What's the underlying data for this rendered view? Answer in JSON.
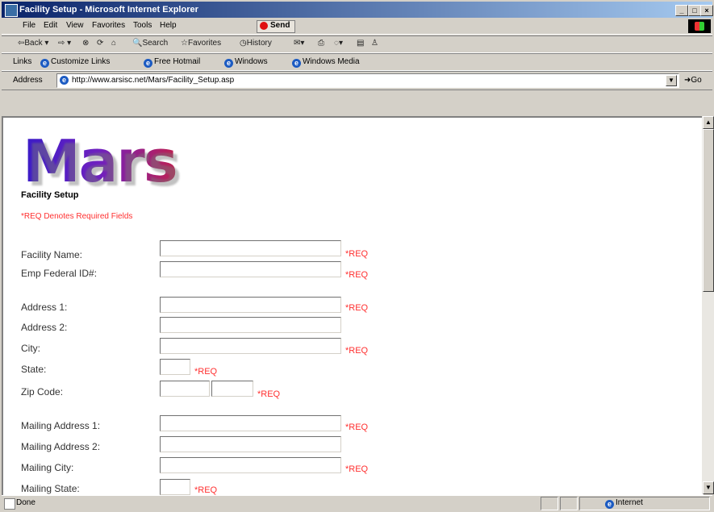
{
  "window": {
    "title": "Facility Setup - Microsoft Internet Explorer"
  },
  "menu": [
    "File",
    "Edit",
    "View",
    "Favorites",
    "Tools",
    "Help"
  ],
  "menu_send": "Send",
  "toolbar": {
    "back": "Back",
    "forward": "",
    "search": "Search",
    "favorites": "Favorites",
    "history": "History"
  },
  "links": {
    "label": "Links",
    "items": [
      "Customize Links",
      "Free Hotmail",
      "Windows",
      "Windows Media"
    ]
  },
  "address": {
    "label": "Address",
    "url": "http://www.arsisc.net/Mars/Facility_Setup.asp",
    "go": "Go"
  },
  "page": {
    "logo": "Mars",
    "title": "Facility Setup",
    "req_note": "*REQ Denotes Required Fields",
    "req_marker": "*REQ",
    "fields": {
      "facility_name": "Facility Name:",
      "emp_federal_id": "Emp Federal ID#:",
      "address1": "Address 1:",
      "address2": "Address 2:",
      "city": "City:",
      "state": "State:",
      "zip": "Zip Code:",
      "mailing_address1": "Mailing Address 1:",
      "mailing_address2": "Mailing Address 2:",
      "mailing_city": "Mailing City:",
      "mailing_state": "Mailing State:"
    }
  },
  "status": {
    "text": "Done",
    "zone": "Internet"
  }
}
